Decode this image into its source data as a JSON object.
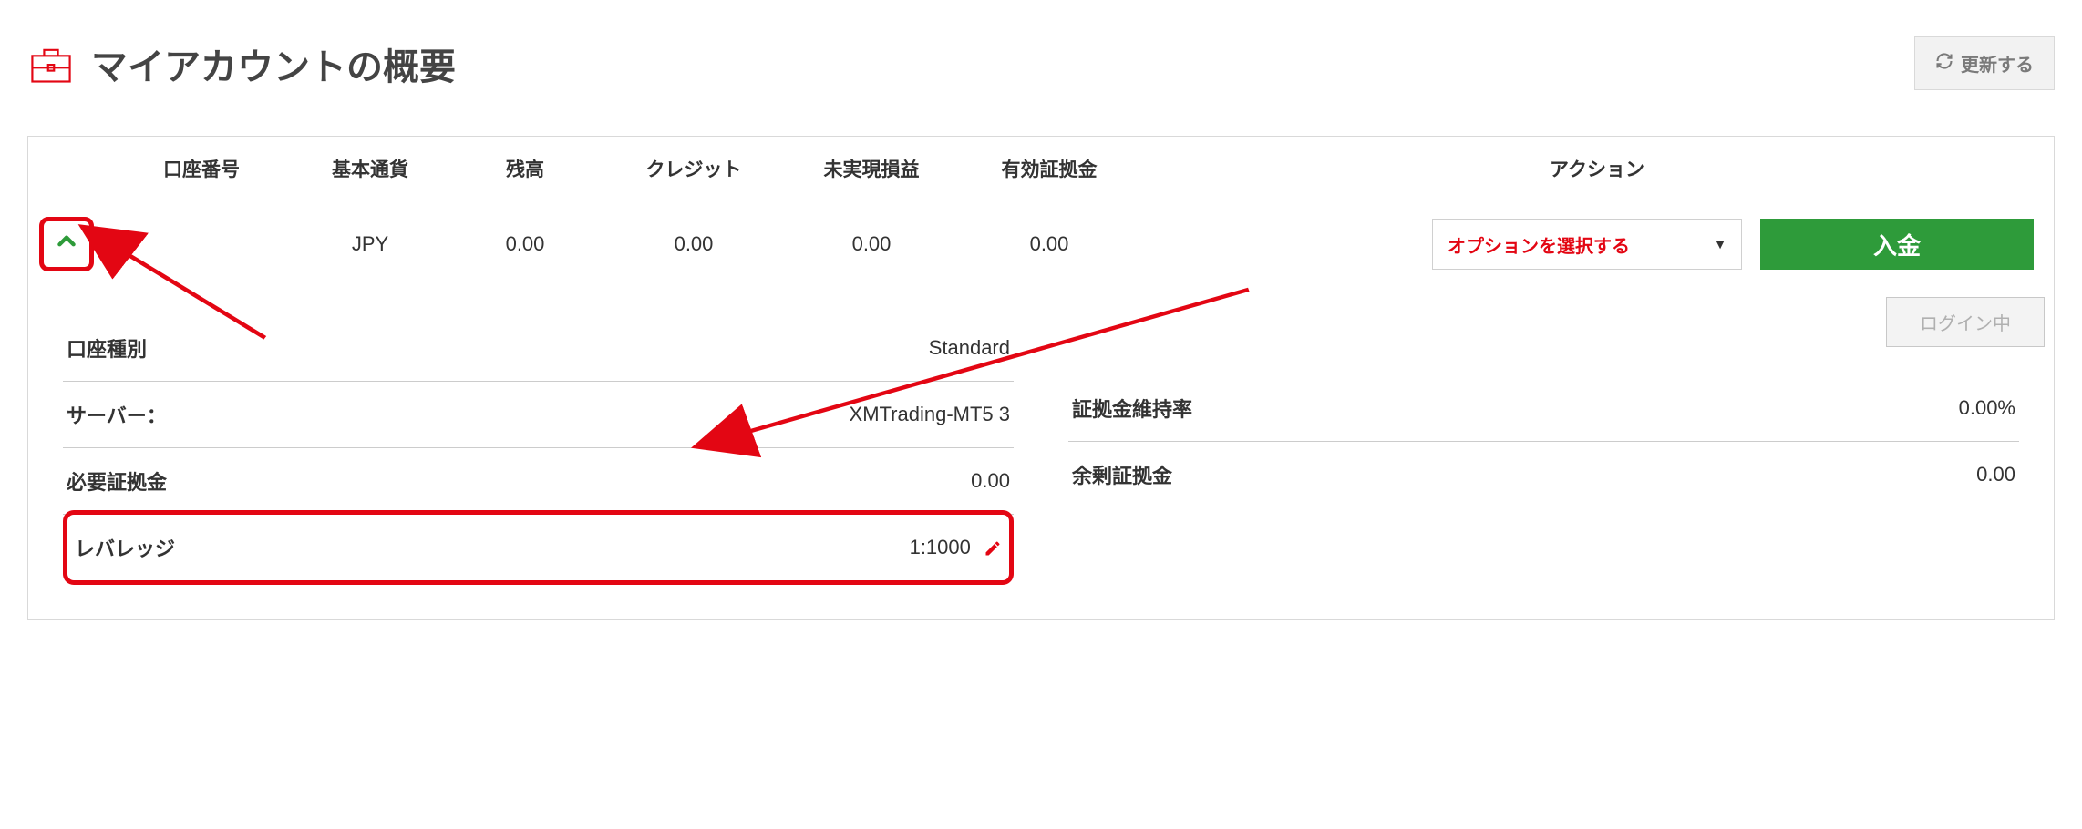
{
  "page": {
    "title": "マイアカウントの概要",
    "refresh_label": "更新する"
  },
  "table": {
    "headers": {
      "account_no": "口座番号",
      "currency": "基本通貨",
      "balance": "残高",
      "credit": "クレジット",
      "unrealized_pl": "未実現損益",
      "equity": "有効証拠金",
      "actions": "アクション"
    },
    "row": {
      "currency": "JPY",
      "balance": "0.00",
      "credit": "0.00",
      "unrealized_pl": "0.00",
      "equity": "0.00",
      "option_select_label": "オプションを選択する",
      "deposit_label": "入金"
    }
  },
  "details": {
    "left": {
      "account_type": {
        "label": "口座種別",
        "value": "Standard"
      },
      "server": {
        "label": "サーバー：",
        "value": "XMTrading-MT5 3"
      },
      "required_margin": {
        "label": "必要証拠金",
        "value": "0.00"
      },
      "leverage": {
        "label": "レバレッジ",
        "value": "1:1000"
      }
    },
    "right": {
      "margin_level": {
        "label": "証拠金維持率",
        "value": "0.00%"
      },
      "free_margin": {
        "label": "余剰証拠金",
        "value": "0.00"
      },
      "login_badge": "ログイン中"
    }
  }
}
